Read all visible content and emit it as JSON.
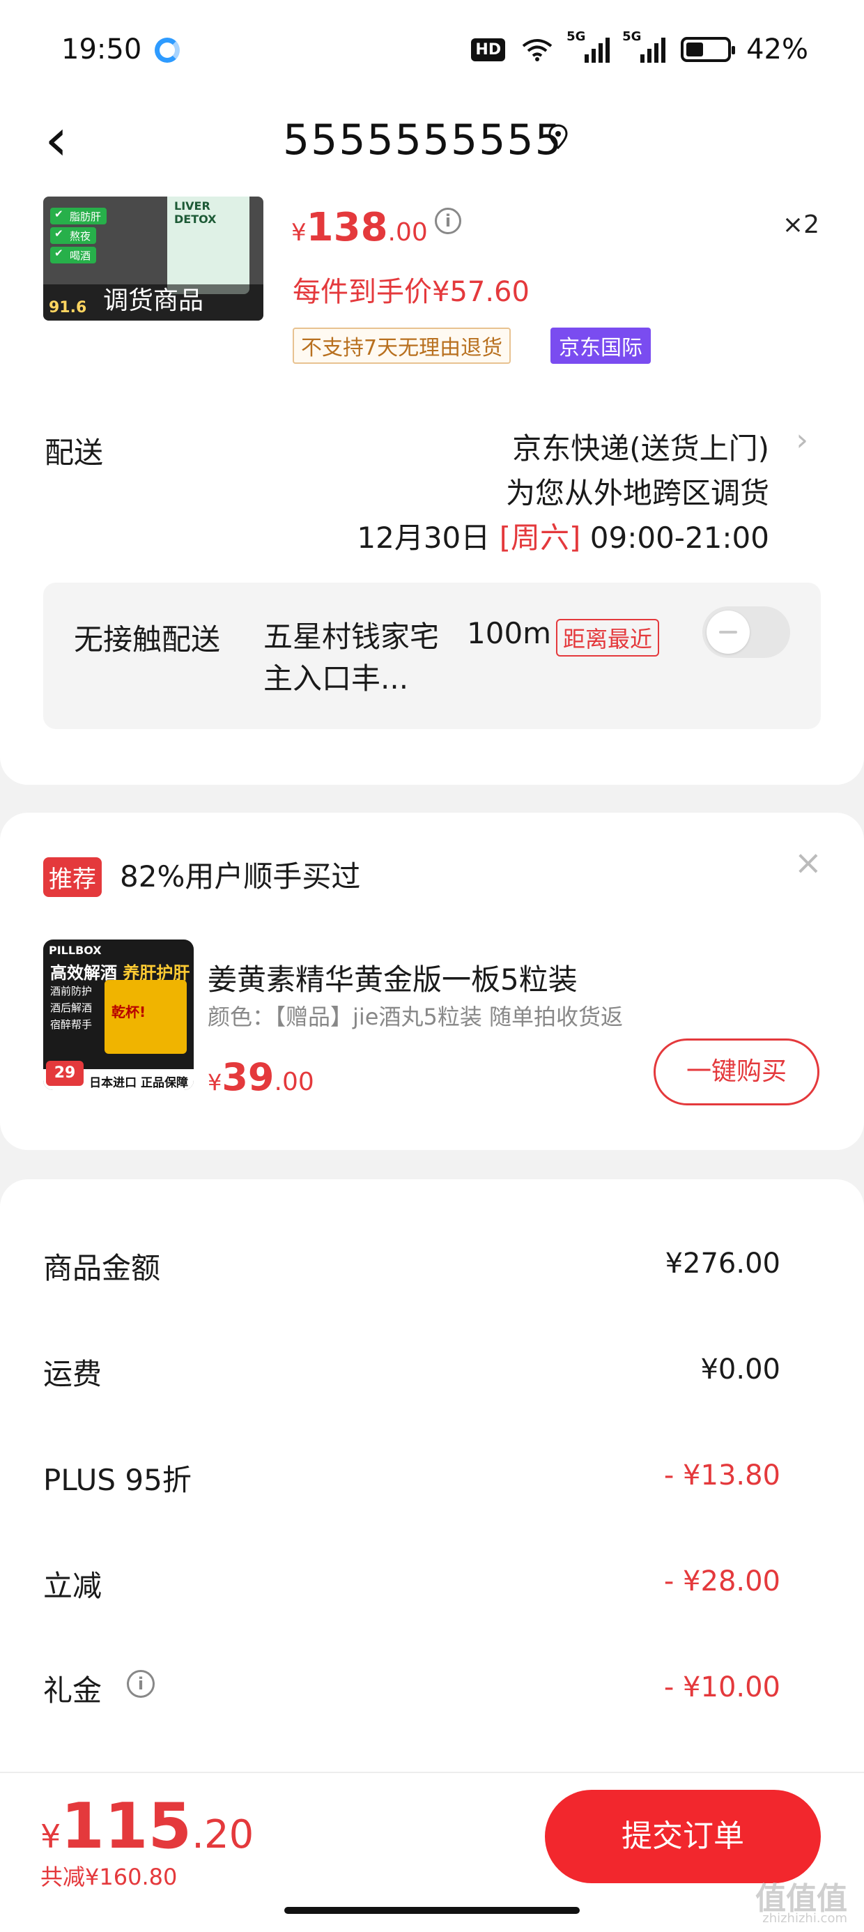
{
  "status_bar": {
    "time": "19:50",
    "hd_label": "HD",
    "network_label": "5G",
    "battery": "42%",
    "battery_level": 0.42
  },
  "header": {
    "back_icon": "chevron-left-icon",
    "title": "5555555555",
    "location_icon": "location-pin-icon"
  },
  "product": {
    "image_overlay_label": "调货商品",
    "image_pills": [
      "脂肪肝",
      "熬夜",
      "喝酒"
    ],
    "image_bottle_text": "LIVER DETOX",
    "image_score": "91.6",
    "price_symbol": "¥",
    "price_int": "138",
    "price_dec": ".00",
    "quantity": "×2",
    "unit_price": "每件到手价¥57.60",
    "tag_noreturn": "不支持7天无理由退货",
    "tag_international": "京东国际"
  },
  "shipping": {
    "label": "配送",
    "method": "京东快递(送货上门)",
    "note": "为您从外地跨区调货",
    "date": "12月30日",
    "weekday": "[周六]",
    "time_range": "09:00-21:00"
  },
  "contactless": {
    "label": "无接触配送",
    "location": "五星村钱家宅主入口丰...",
    "distance": "100m",
    "nearest_tag": "距离最近",
    "toggle_on": false
  },
  "recommend": {
    "tag": "推荐",
    "title": "82%用户顺手买过",
    "product_name": "姜黄素精华黄金版一板5粒装",
    "spec": "颜色：【赠品】jie酒丸5粒装 随单拍收货返",
    "price_symbol": "¥",
    "price_int": "39",
    "price_dec": ".00",
    "buy_button": "一键购买",
    "thumb": {
      "brand": "PILLBOX",
      "headline_a": "高效解酒",
      "headline_b": "养肝护肝",
      "list": [
        "酒前防护",
        "酒后解酒",
        "宿醉帮手"
      ],
      "box_text": "乾杯!",
      "badge": "29",
      "footer": "日本进口 正品保障"
    }
  },
  "amounts": [
    {
      "label": "商品金额",
      "value": "¥276.00",
      "discount": false
    },
    {
      "label": "运费",
      "value": "¥0.00",
      "discount": false
    },
    {
      "label": "PLUS 95折",
      "value": "- ¥13.80",
      "discount": true
    },
    {
      "label": "立减",
      "value": "- ¥28.00",
      "discount": true
    },
    {
      "label": "礼金",
      "value": "- ¥10.00",
      "discount": true
    }
  ],
  "bottom": {
    "total_symbol": "¥",
    "total_int": "115",
    "total_dec": ".20",
    "saved": "共减¥160.80",
    "submit": "提交订单"
  },
  "watermark": {
    "logo": "值值值",
    "url": "zhizhizhi.com"
  },
  "colors": {
    "accent_red": "#e4393c",
    "submit_red": "#f2272d",
    "intl_purple": "#7a4cf0"
  }
}
